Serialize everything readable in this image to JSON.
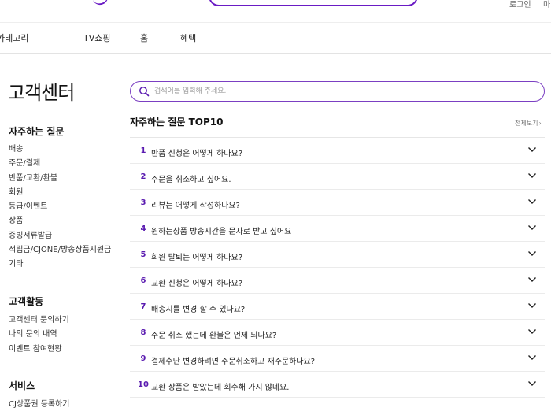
{
  "header": {
    "login_label": "로그인",
    "more_label": "마"
  },
  "gnb": {
    "category_label": "카테고리",
    "items": [
      "TV쇼핑",
      "홈",
      "혜택"
    ]
  },
  "sidebar": {
    "page_title": "고객센터",
    "faq_group": {
      "title": "자주하는 질문",
      "items": [
        "배송",
        "주문/결제",
        "반품/교환/환불",
        "회원",
        "등급/이벤트",
        "상품",
        "증빙서류발급",
        "적립금/CJONE/방송상품지원금",
        "기타"
      ]
    },
    "activity_group": {
      "title": "고객활동",
      "items": [
        "고객센터 문의하기",
        "나의 문의 내역",
        "이벤트 참여현황"
      ]
    },
    "service_group": {
      "title": "서비스",
      "items": [
        "CJ상품권 등록하기"
      ]
    }
  },
  "search": {
    "placeholder": "검색어를 입력해 주세요."
  },
  "faq": {
    "title": "자주하는 질문 TOP10",
    "view_all_label": "전체보기",
    "items": [
      {
        "num": "1",
        "question": "반품 신청은 어떻게 하나요?"
      },
      {
        "num": "2",
        "question": "주문을 취소하고 싶어요."
      },
      {
        "num": "3",
        "question": "리뷰는 어떻게 작성하나요?"
      },
      {
        "num": "4",
        "question": "원하는상품 방송시간을 문자로 받고 싶어요"
      },
      {
        "num": "5",
        "question": "회원 탈퇴는 어떻게 하나요?"
      },
      {
        "num": "6",
        "question": "교환 신청은 어떻게 하나요?"
      },
      {
        "num": "7",
        "question": "배송지를 변경 할 수 있나요?"
      },
      {
        "num": "8",
        "question": "주문 취소 했는데 환불은 언제 되나요?"
      },
      {
        "num": "9",
        "question": "결제수단 변경하려면 주문취소하고 재주문하나요?"
      },
      {
        "num": "10",
        "question": "교환 상품은 받았는데 회수해 가지 않네요."
      }
    ]
  },
  "colors": {
    "accent": "#6a1bc4",
    "number": "#5a1bb0"
  }
}
